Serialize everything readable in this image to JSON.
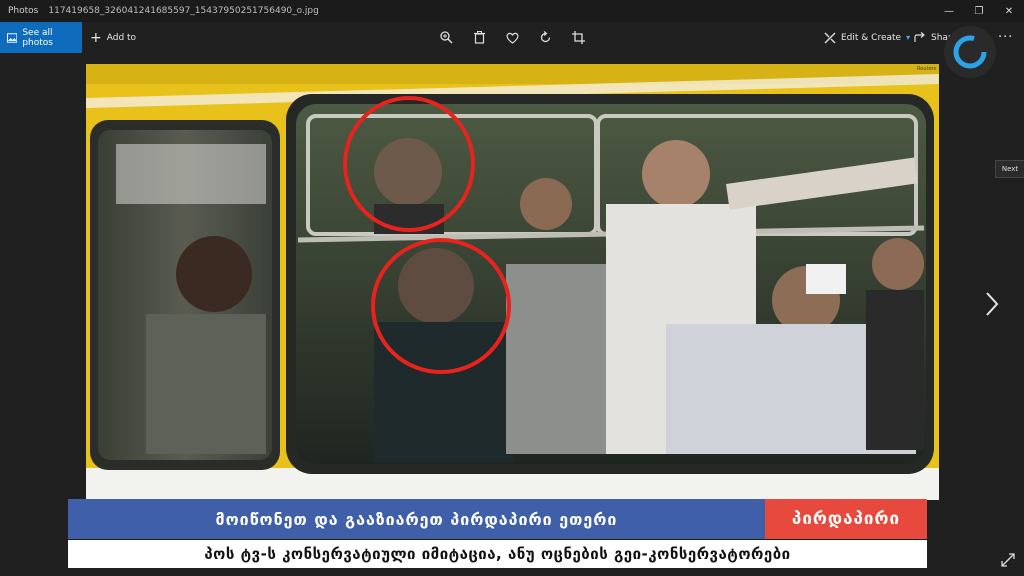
{
  "window": {
    "app_name": "Photos",
    "file_name": "117419658_326041241685597_1543795025175649​0_o.jpg",
    "minimize": "—",
    "maximize": "❐",
    "close": "✕"
  },
  "toolbar": {
    "see_all_photos": "See all photos",
    "add_to": "Add to",
    "edit_create": "Edit & Create",
    "share": "Share",
    "more": "···"
  },
  "photo": {
    "source_label": "Reuters",
    "highlight_color": "#e8231d"
  },
  "nav": {
    "next_tooltip": "Next"
  },
  "broadcast": {
    "headline": "მოიწონეთ და გააზიარეთ პირდაპირი ეთერი",
    "live_badge": "პირდაპირი",
    "caption": "პოს ტვ-ს კონსერვატიული იმიტაცია, ანუ ოცნების გეი-კონსერვატორები"
  },
  "colors": {
    "accent": "#0f6cbd",
    "headline_bg": "#3f5fa8",
    "badge_bg": "#e8493d",
    "bus_yellow": "#e8c21b"
  }
}
